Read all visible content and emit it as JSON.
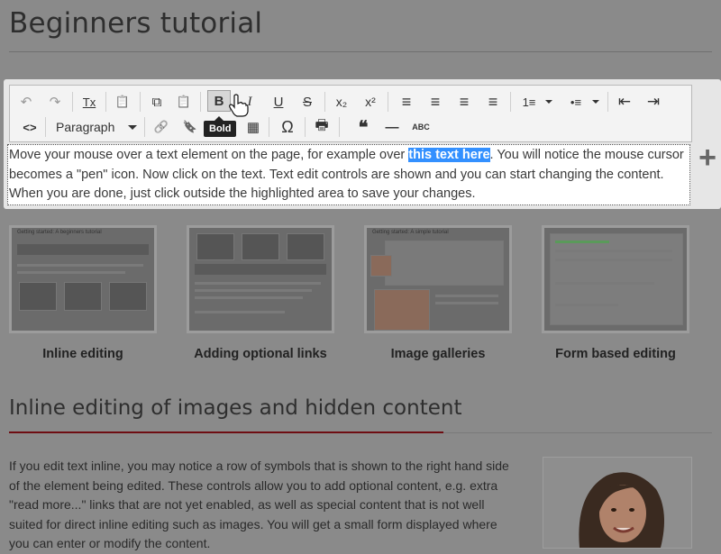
{
  "page": {
    "title": "Beginners tutorial"
  },
  "toolbar": {
    "format_value": "Paragraph",
    "tooltip": "Bold",
    "buttons": [
      {
        "name": "undo-icon",
        "glyph": "↶"
      },
      {
        "name": "redo-icon",
        "glyph": "↷"
      },
      {
        "name": "remove-format-icon",
        "glyph": "Tx"
      },
      {
        "name": "paste-icon",
        "glyph": "📋"
      },
      {
        "name": "copy-icon",
        "glyph": "⧉"
      },
      {
        "name": "paste-text-icon",
        "glyph": "📋"
      },
      {
        "name": "bold-icon",
        "glyph": "B"
      },
      {
        "name": "italic-icon",
        "glyph": "I"
      },
      {
        "name": "underline-icon",
        "glyph": "U"
      },
      {
        "name": "strikethrough-icon",
        "glyph": "S"
      },
      {
        "name": "subscript-icon",
        "glyph": "x₂"
      },
      {
        "name": "superscript-icon",
        "glyph": "x²"
      },
      {
        "name": "align-left-icon",
        "glyph": "≡"
      },
      {
        "name": "align-center-icon",
        "glyph": "≡"
      },
      {
        "name": "align-right-icon",
        "glyph": "≡"
      },
      {
        "name": "align-justify-icon",
        "glyph": "≡"
      },
      {
        "name": "numbered-list-icon",
        "glyph": "1≡"
      },
      {
        "name": "bullet-list-icon",
        "glyph": "•≡"
      },
      {
        "name": "outdent-icon",
        "glyph": "⇤"
      },
      {
        "name": "indent-icon",
        "glyph": "⇥"
      },
      {
        "name": "source-code-icon",
        "glyph": "<>"
      },
      {
        "name": "link-icon",
        "glyph": "🔗"
      },
      {
        "name": "bookmark-icon",
        "glyph": "🔖"
      },
      {
        "name": "table-icon",
        "glyph": "▦"
      },
      {
        "name": "special-char-icon",
        "glyph": "Ω"
      },
      {
        "name": "print-icon",
        "glyph": "🖶"
      },
      {
        "name": "blockquote-icon",
        "glyph": "❝"
      },
      {
        "name": "horizontal-rule-icon",
        "glyph": "—"
      },
      {
        "name": "spellcheck-icon",
        "glyph": "ABC"
      }
    ]
  },
  "editor": {
    "text_before": "Move your mouse over a text element on the page, for example over ",
    "text_highlight": "this text here",
    "text_after": ". You will notice the mouse cursor becomes a \"pen\" icon. Now click on the text. Text edit controls are shown and you can start changing the content. When you are done, just click outside the highlighted area to save your changes.",
    "add_symbol": "+"
  },
  "thumbnails": [
    {
      "caption": "Inline editing",
      "mini_title": "Getting started: A beginners tutorial"
    },
    {
      "caption": "Adding optional links",
      "mini_title": ""
    },
    {
      "caption": "Image galleries",
      "mini_title": "Getting started: A simple tutorial"
    },
    {
      "caption": "Form based editing",
      "mini_title": ""
    }
  ],
  "section": {
    "title": "Inline editing of images and hidden content",
    "body": "If you edit text inline, you may notice a row of symbols that is shown to the right hand side of the element being edited. These controls allow you to add optional content, e.g. extra \"read more...\" links that are not yet enabled, as well as special content that is not well suited for direct inline editing such as images. You will get a small form displayed where you can enter or modify the content."
  },
  "colors": {
    "background": "#8a8a8a",
    "highlight": "#3390ff",
    "accent_rule": "#6e0d12"
  }
}
